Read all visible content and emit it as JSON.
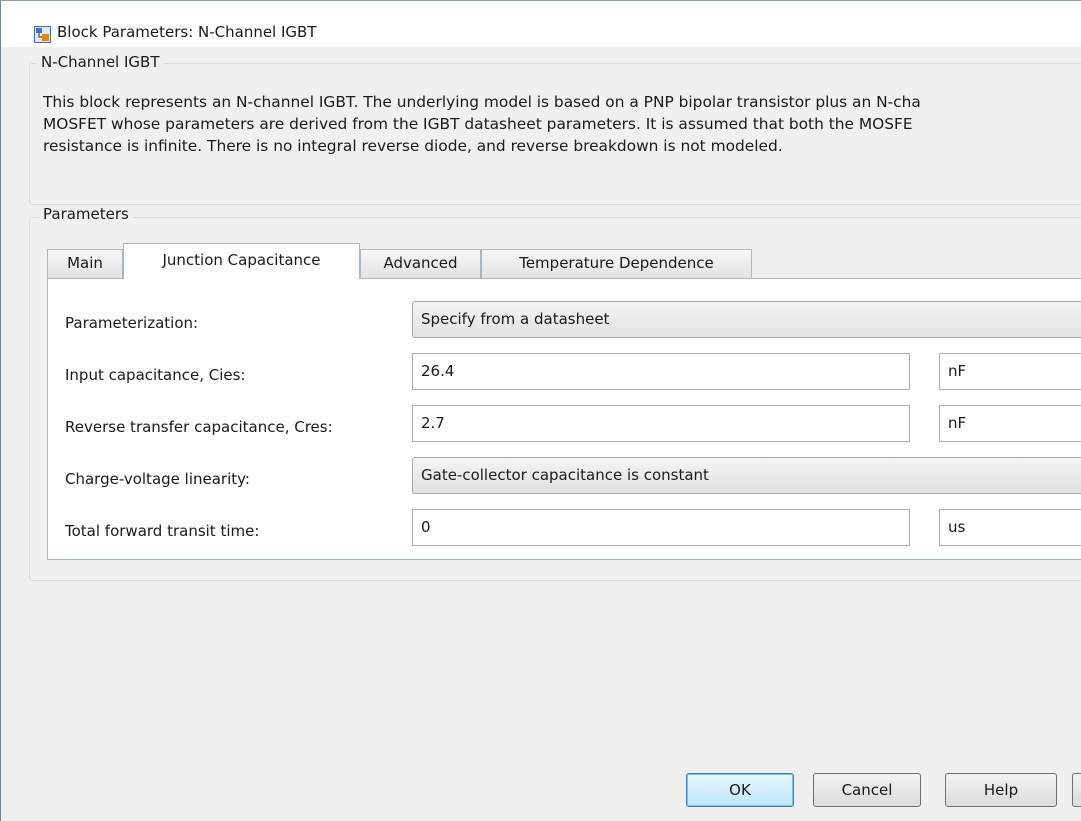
{
  "window": {
    "title": "Block Parameters: N-Channel IGBT",
    "icon": "simulink-block-icon"
  },
  "block_group": {
    "legend": "N-Channel IGBT",
    "description_lines": [
      "This block represents an N-channel IGBT. The underlying model is based on a PNP bipolar transistor plus an N-cha",
      "MOSFET whose parameters are derived from the IGBT datasheet parameters. It is assumed that both the MOSFE",
      "resistance is infinite. There is no integral reverse diode, and reverse breakdown is not modeled."
    ]
  },
  "parameters_group": {
    "legend": "Parameters",
    "tabs": [
      {
        "label": "Main"
      },
      {
        "label": "Junction Capacitance",
        "active": true
      },
      {
        "label": "Advanced"
      },
      {
        "label": "Temperature Dependence"
      }
    ],
    "fields": {
      "parameterization": {
        "label": "Parameterization:",
        "value": "Specify from a datasheet"
      },
      "input_capacitance": {
        "label": "Input capacitance, Cies:",
        "value": "26.4",
        "unit": "nF"
      },
      "reverse_transfer": {
        "label": "Reverse transfer capacitance, Cres:",
        "value": "2.7",
        "unit": "nF"
      },
      "charge_voltage": {
        "label": "Charge-voltage linearity:",
        "value": "Gate-collector capacitance is constant"
      },
      "transit_time": {
        "label": "Total forward transit time:",
        "value": "0",
        "unit": "us"
      }
    }
  },
  "buttons": {
    "ok": "OK",
    "cancel": "Cancel",
    "help": "Help"
  }
}
